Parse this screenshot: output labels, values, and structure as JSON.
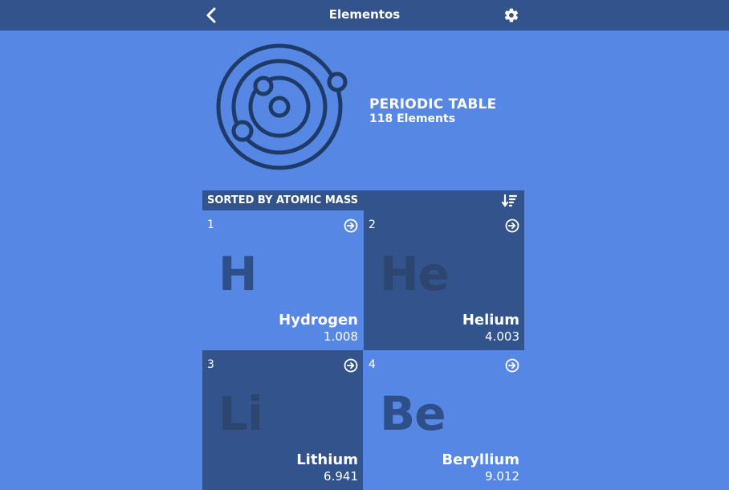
{
  "app": {
    "title": "Elementos",
    "back_icon": "chevron-left-icon",
    "settings_icon": "gear-icon"
  },
  "hero": {
    "icon": "atom-orbit-icon",
    "title": "PERIODIC TABLE",
    "subtitle": "118 Elements"
  },
  "list": {
    "header_label": "SORTED BY ATOMIC MASS",
    "sort_icon": "sort-descending-icon",
    "elements": [
      {
        "number": "1",
        "symbol": "H",
        "name": "Hydrogen",
        "mass": "1.008"
      },
      {
        "number": "2",
        "symbol": "He",
        "name": "Helium",
        "mass": "4.003"
      },
      {
        "number": "3",
        "symbol": "Li",
        "name": "Lithium",
        "mass": "6.941"
      },
      {
        "number": "4",
        "symbol": "Be",
        "name": "Beryllium",
        "mass": "9.012"
      }
    ]
  },
  "colors": {
    "background": "#5787e4",
    "bar": "#33538c",
    "icon_stroke": "#1e3a66",
    "text": "#ffffff"
  }
}
